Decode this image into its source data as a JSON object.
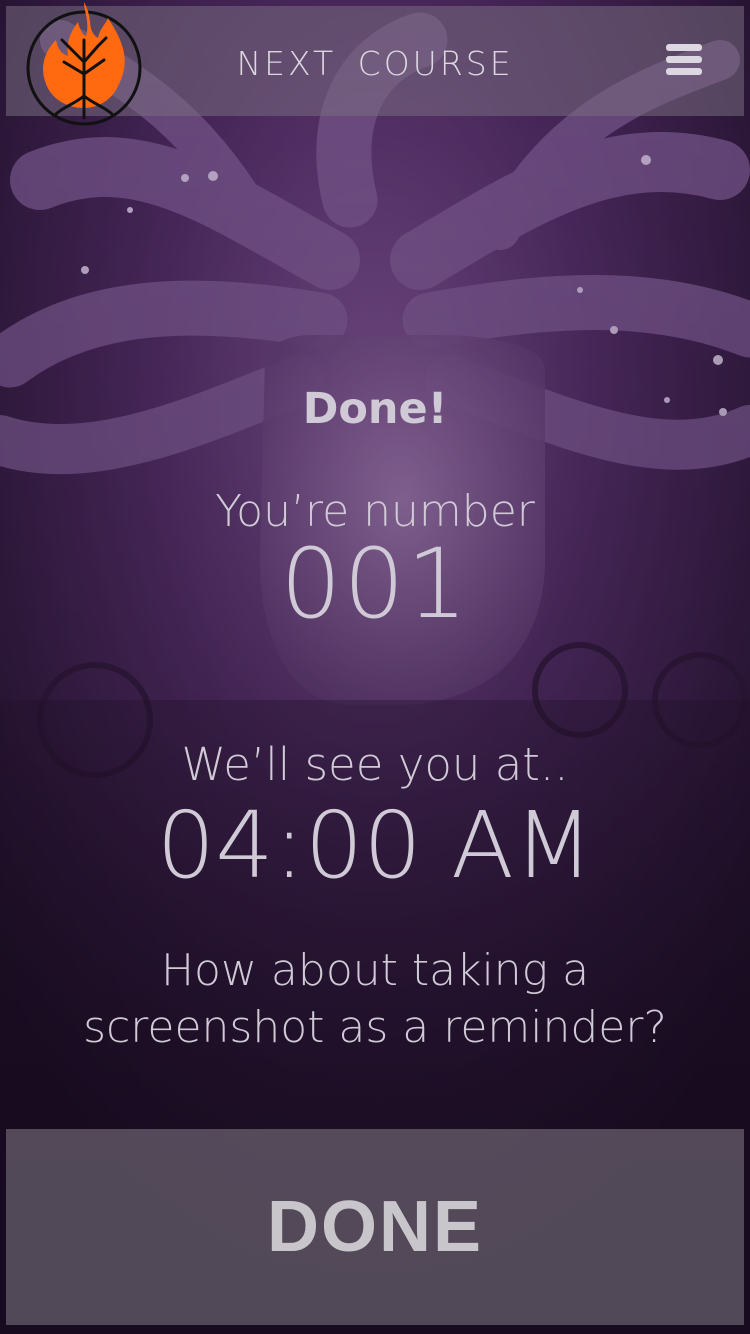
{
  "header": {
    "title": "NEXT  COURSE",
    "logo_icon": "flame-tree-logo",
    "menu_icon": "hamburger-menu-icon"
  },
  "confirmation": {
    "heading": "Done!",
    "number_label": "You’re number",
    "number_value": "001",
    "see_you_label": "We’ll see you at..",
    "time_value": "04:00 AM",
    "reminder_line1": "How about taking a",
    "reminder_line2": "screenshot as a reminder?"
  },
  "footer": {
    "done_label": "DONE"
  },
  "colors": {
    "accent_orange": "#ff6a10",
    "text": "#cfcad6",
    "overlay_purple": "#3a2248"
  }
}
